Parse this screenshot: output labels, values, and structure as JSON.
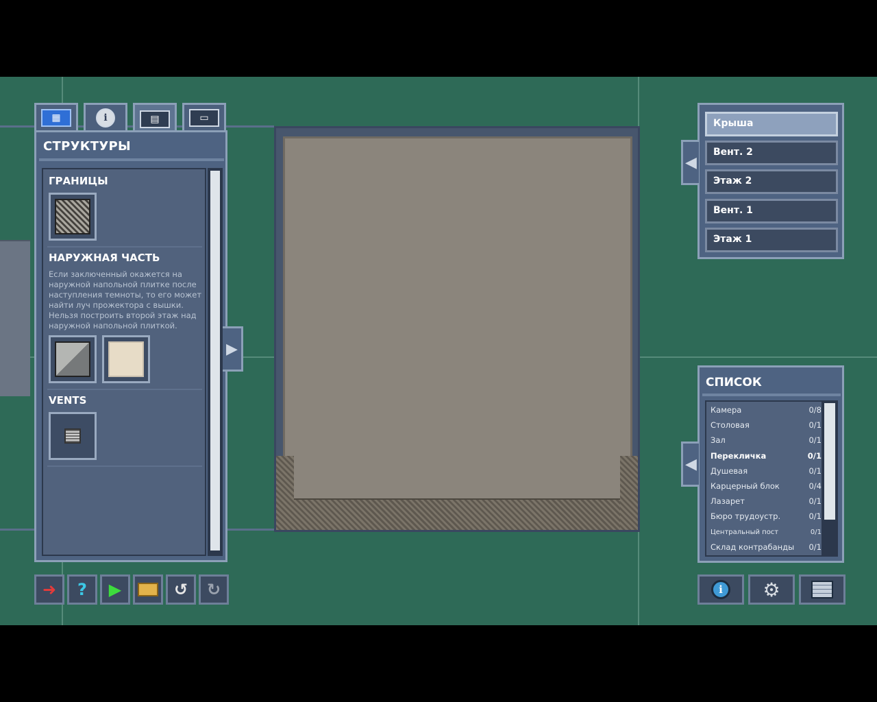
{
  "structures_panel": {
    "title": "СТРУКТУРЫ",
    "tabs": [
      {
        "icon": "blueprint-icon"
      },
      {
        "icon": "info-pencil-icon"
      },
      {
        "icon": "structures-icon"
      },
      {
        "icon": "objects-icon"
      }
    ],
    "sections": [
      {
        "heading": "ГРАНИЦЫ",
        "items": [
          {
            "icon": "fence-icon"
          }
        ]
      },
      {
        "heading": "НАРУЖНАЯ ЧАСТЬ",
        "description": "Если заключенный окажется на наружной напольной плитке после наступления темноты, то его может найти луч прожектора с вышки. Нельзя построить второй этаж над наружной напольной плиткой.",
        "items": [
          {
            "icon": "outdoor-wall-icon"
          },
          {
            "icon": "outdoor-floor-icon"
          }
        ]
      },
      {
        "heading": "VENTS",
        "items": [
          {
            "icon": "vent-icon"
          }
        ]
      }
    ]
  },
  "floors": {
    "items": [
      "Крыша",
      "Вент. 2",
      "Этаж 2",
      "Вент. 1",
      "Этаж 1"
    ],
    "selected": "Крыша"
  },
  "list_panel": {
    "title": "СПИСОК",
    "rows": [
      {
        "name": "Камера",
        "count": "0/8"
      },
      {
        "name": "Столовая",
        "count": "0/1"
      },
      {
        "name": "Зал",
        "count": "0/1"
      },
      {
        "name": "Перекличка",
        "count": "0/1"
      },
      {
        "name": "Душевая",
        "count": "0/1"
      },
      {
        "name": "Карцерный блок",
        "count": "0/4"
      },
      {
        "name": "Лазарет",
        "count": "0/1"
      },
      {
        "name": "Бюро трудоустр.",
        "count": "0/1"
      },
      {
        "name": "Центральный пост",
        "count": "0/1"
      },
      {
        "name": "Склад контрабанды",
        "count": "0/1"
      }
    ]
  },
  "toolbar": {
    "help_glyph": "?",
    "tools": [
      "exit-icon",
      "help-icon",
      "play-icon",
      "folder-icon",
      "undo-icon",
      "redo-icon"
    ]
  },
  "colors": {
    "grass": "#2e6a57",
    "panel": "#4e6382",
    "panel_border": "#8ca0b8",
    "floor": "#8b857c"
  }
}
